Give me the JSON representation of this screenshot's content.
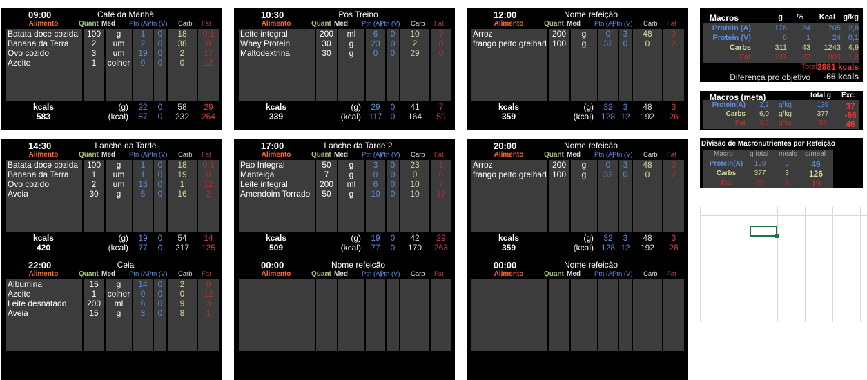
{
  "columns": {
    "food": "Alimento",
    "qty": "Quant",
    "unit": "Med",
    "ptn_a": "Ptn (A)",
    "ptn_v": "Ptn (V)",
    "carb": "Carb",
    "fat": "Fat"
  },
  "totals_labels": {
    "kcals": "kcals",
    "g": "(g)",
    "kcal": "(kcal)"
  },
  "meals": [
    {
      "time": "09:00",
      "name": "Café da Manhã",
      "items": [
        {
          "food": "Batata doce cozida",
          "qty": "100",
          "unit": "g",
          "pa": "1",
          "pv": "0",
          "carb": "18",
          "fat": "0,1"
        },
        {
          "food": "Banana da Terra",
          "qty": "2",
          "unit": "um",
          "pa": "2",
          "pv": "0",
          "carb": "38",
          "fat": "0"
        },
        {
          "food": "Ovo cozido",
          "qty": "3",
          "unit": "um",
          "pa": "19",
          "pv": "0",
          "carb": "2",
          "fat": "17"
        },
        {
          "food": "Azeite",
          "qty": "1",
          "unit": "colher",
          "pa": "0",
          "pv": "0",
          "carb": "0",
          "fat": "12"
        }
      ],
      "kcal_total": "583",
      "g": {
        "pa": "22",
        "pv": "0",
        "carb": "58",
        "fat": "29"
      },
      "kc": {
        "pa": "87",
        "pv": "0",
        "carb": "232",
        "fat": "264"
      }
    },
    {
      "time": "10:30",
      "name": "Pós Treino",
      "items": [
        {
          "food": "Leite integral",
          "qty": "200",
          "unit": "ml",
          "pa": "6",
          "pv": "0",
          "carb": "10",
          "fat": "7"
        },
        {
          "food": "Whey Protein",
          "qty": "30",
          "unit": "g",
          "pa": "23",
          "pv": "0",
          "carb": "2",
          "fat": "0"
        },
        {
          "food": "Maltodextrina",
          "qty": "30",
          "unit": "g",
          "pa": "0",
          "pv": "0",
          "carb": "29",
          "fat": "0"
        }
      ],
      "kcal_total": "339",
      "g": {
        "pa": "29",
        "pv": "0",
        "carb": "41",
        "fat": "7"
      },
      "kc": {
        "pa": "117",
        "pv": "0",
        "carb": "164",
        "fat": "59"
      }
    },
    {
      "time": "12:00",
      "name": "Nome refeição",
      "items": [
        {
          "food": "Arroz",
          "qty": "200",
          "unit": "g",
          "pa": "0",
          "pv": "3",
          "carb": "48",
          "fat": "0"
        },
        {
          "food": "frango peito grelhado",
          "qty": "100",
          "unit": "g",
          "pa": "32",
          "pv": "0",
          "carb": "0",
          "fat": "2"
        }
      ],
      "kcal_total": "359",
      "g": {
        "pa": "32",
        "pv": "3",
        "carb": "48",
        "fat": "3"
      },
      "kc": {
        "pa": "128",
        "pv": "12",
        "carb": "192",
        "fat": "26"
      }
    },
    {
      "time": "14:30",
      "name": "Lanche da Tarde",
      "items": [
        {
          "food": "Batata doce cozida",
          "qty": "100",
          "unit": "g",
          "pa": "1",
          "pv": "0",
          "carb": "18",
          "fat": "0,1"
        },
        {
          "food": "Banana da Terra",
          "qty": "1",
          "unit": "um",
          "pa": "1",
          "pv": "0",
          "carb": "19",
          "fat": "0"
        },
        {
          "food": "Ovo cozido",
          "qty": "2",
          "unit": "um",
          "pa": "13",
          "pv": "0",
          "carb": "1",
          "fat": "12"
        },
        {
          "food": "Aveia",
          "qty": "30",
          "unit": "g",
          "pa": "5",
          "pv": "0",
          "carb": "16",
          "fat": "2"
        }
      ],
      "kcal_total": "420",
      "g": {
        "pa": "19",
        "pv": "0",
        "carb": "54",
        "fat": "14"
      },
      "kc": {
        "pa": "77",
        "pv": "0",
        "carb": "217",
        "fat": "125"
      }
    },
    {
      "time": "17:00",
      "name": "Lanche da Tarde 2",
      "items": [
        {
          "food": "Pao Integral",
          "qty": "50",
          "unit": "g",
          "pa": "3",
          "pv": "0",
          "carb": "23",
          "fat": "1"
        },
        {
          "food": "Manteiga",
          "qty": "7",
          "unit": "g",
          "pa": "0",
          "pv": "0",
          "carb": "0",
          "fat": "6"
        },
        {
          "food": "Leite integral",
          "qty": "200",
          "unit": "ml",
          "pa": "6",
          "pv": "0",
          "carb": "10",
          "fat": "7"
        },
        {
          "food": "Amendoim Torrado",
          "qty": "50",
          "unit": "g",
          "pa": "10",
          "pv": "0",
          "carb": "10",
          "fat": "17"
        }
      ],
      "kcal_total": "509",
      "g": {
        "pa": "19",
        "pv": "0",
        "carb": "42",
        "fat": "29"
      },
      "kc": {
        "pa": "77",
        "pv": "0",
        "carb": "170",
        "fat": "263"
      }
    },
    {
      "time": "20:00",
      "name": "Nome refeicão",
      "items": [
        {
          "food": "Arroz",
          "qty": "200",
          "unit": "g",
          "pa": "0",
          "pv": "3",
          "carb": "48",
          "fat": "0"
        },
        {
          "food": "frango peito grelhado",
          "qty": "100",
          "unit": "g",
          "pa": "32",
          "pv": "0",
          "carb": "0",
          "fat": "2"
        }
      ],
      "kcal_total": "359",
      "g": {
        "pa": "32",
        "pv": "3",
        "carb": "48",
        "fat": "3"
      },
      "kc": {
        "pa": "128",
        "pv": "12",
        "carb": "192",
        "fat": "26"
      }
    },
    {
      "time": "22:00",
      "name": "Ceia",
      "items": [
        {
          "food": "Albumina",
          "qty": "15",
          "unit": "g",
          "pa": "14",
          "pv": "0",
          "carb": "2",
          "fat": "0"
        },
        {
          "food": "Azeite",
          "qty": "1",
          "unit": "colher",
          "pa": "0",
          "pv": "0",
          "carb": "0",
          "fat": "12"
        },
        {
          "food": "Leite desnatado",
          "qty": "200",
          "unit": "ml",
          "pa": "6",
          "pv": "0",
          "carb": "9",
          "fat": "3"
        },
        {
          "food": "Aveia",
          "qty": "15",
          "unit": "g",
          "pa": "3",
          "pv": "0",
          "carb": "8",
          "fat": "1"
        }
      ]
    },
    {
      "time": "00:00",
      "name": "Nome refeicão",
      "items": []
    },
    {
      "time": "00:00",
      "name": "Nome refeicão",
      "items": []
    }
  ],
  "macros": {
    "title": "Macros",
    "headers": [
      "g",
      "%",
      "Kcal",
      "g/kg"
    ],
    "rows": [
      {
        "label": "Protein (A)",
        "g": "176",
        "pct": "24",
        "kcal": "705",
        "gkg": "2,8",
        "color": "#5b8de0"
      },
      {
        "label": "Protein (V)",
        "g": "6",
        "pct": "1",
        "kcal": "24",
        "gkg": "0,1",
        "color": "#5b8de0"
      },
      {
        "label": "Carbs",
        "g": "311",
        "pct": "43",
        "kcal": "1243",
        "gkg": "4,9",
        "color": "#d8d8a0"
      },
      {
        "label": "Fat",
        "g": "101",
        "pct": "32",
        "kcal": "909",
        "gkg": "1,6",
        "color": "#b03030"
      }
    ],
    "total_label": "Total",
    "total_value": "2881 kcals",
    "diff_label": "Diferença pro objetivo",
    "diff_value": "-66 kcals"
  },
  "meta": {
    "title": "Macros (meta)",
    "headers": [
      "total g",
      "Exc."
    ],
    "rows": [
      {
        "label": "Protein(A)",
        "gkg": "2,2",
        "unit": "g/kg",
        "total": "139",
        "exc": "37",
        "color": "#5b8de0"
      },
      {
        "label": "Carbs",
        "gkg": "6,0",
        "unit": "g/kg",
        "total": "377",
        "exc": "-66",
        "color": "#d8d8a0"
      },
      {
        "label": "Fat",
        "gkg": "0,9",
        "unit": "g/kg",
        "total": "56",
        "exc": "46",
        "color": "#b03030"
      }
    ]
  },
  "division": {
    "title": "Divisão de Macronutrientes por Refeição",
    "headers": [
      "Macro",
      "g total",
      "meals",
      "g/meal"
    ],
    "rows": [
      {
        "label": "Protein(A)",
        "total": "139",
        "meals": "3",
        "per": "46",
        "color": "#5b8de0"
      },
      {
        "label": "Carbs",
        "total": "377",
        "meals": "3",
        "per": "126",
        "color": "#d8d8a0"
      },
      {
        "label": "Fat",
        "total": "56",
        "meals": "3",
        "per": "19",
        "color": "#b03030"
      }
    ]
  }
}
